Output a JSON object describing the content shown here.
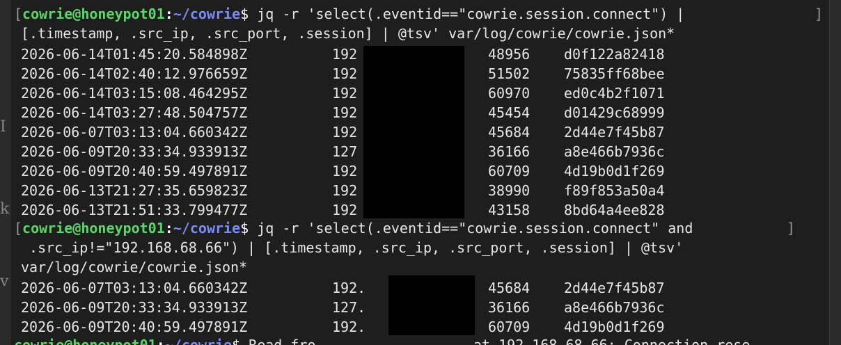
{
  "prompt": {
    "user": "cowrie",
    "at": "@",
    "host": "honeypot01",
    "colon": ":",
    "path": "~/cowrie",
    "symbol": "$",
    "open_bracket": "[",
    "close_bracket": "]"
  },
  "command1": {
    "line1": " jq -r 'select(.eventid==\"cowrie.session.connect\") | ",
    "line2": "[.timestamp, .src_ip, .src_port, .session] | @tsv' var/log/cowrie/cowrie.json*"
  },
  "output1": [
    {
      "timestamp": "2026-06-14T01:45:20.584898Z",
      "ip": "192",
      "port": "48956",
      "session": "d0f122a82418"
    },
    {
      "timestamp": "2026-06-14T02:40:12.976659Z",
      "ip": "192",
      "port": "51502",
      "session": "75835ff68bee"
    },
    {
      "timestamp": "2026-06-14T03:15:08.464295Z",
      "ip": "192",
      "port": "60970",
      "session": "ed0c4b2f1071"
    },
    {
      "timestamp": "2026-06-14T03:27:48.504757Z",
      "ip": "192",
      "port": "45454",
      "session": "d01429c68999"
    },
    {
      "timestamp": "2026-06-07T03:13:04.660342Z",
      "ip": "192",
      "port": "45684",
      "session": "2d44e7f45b87"
    },
    {
      "timestamp": "2026-06-09T20:33:34.933913Z",
      "ip": "127",
      "port": "36166",
      "session": "a8e466b7936c"
    },
    {
      "timestamp": "2026-06-09T20:40:59.497891Z",
      "ip": "192",
      "port": "60709",
      "session": "4d19b0d1f269"
    },
    {
      "timestamp": "2026-06-13T21:27:35.659823Z",
      "ip": "192",
      "port": "38990",
      "session": "f89f853a50a4"
    },
    {
      "timestamp": "2026-06-13T21:51:33.799477Z",
      "ip": "192",
      "port": "43158",
      "session": "8bd64a4ee828"
    }
  ],
  "command2": {
    "line1": " jq -r 'select(.eventid==\"cowrie.session.connect\" and",
    "line2": " .src_ip!=\"192.168.68.66\") | [.timestamp, .src_ip, .src_port, .session] | @tsv'",
    "line3": "var/log/cowrie/cowrie.json*"
  },
  "output2": [
    {
      "timestamp": "2026-06-07T03:13:04.660342Z",
      "ip": "192.",
      "port": "45684",
      "session": "2d44e7f45b87"
    },
    {
      "timestamp": "2026-06-09T20:33:34.933913Z",
      "ip": "127.",
      "port": "36166",
      "session": "a8e466b7936c"
    },
    {
      "timestamp": "2026-06-09T20:40:59.497891Z",
      "ip": "192.",
      "port": "60709",
      "session": "4d19b0d1f269"
    }
  ],
  "partial_line": {
    "text": " Read fro",
    "tail": "at 192.168.68.66: Connection rese"
  },
  "left_strip_glyphs": [
    "I",
    "k",
    "v"
  ]
}
